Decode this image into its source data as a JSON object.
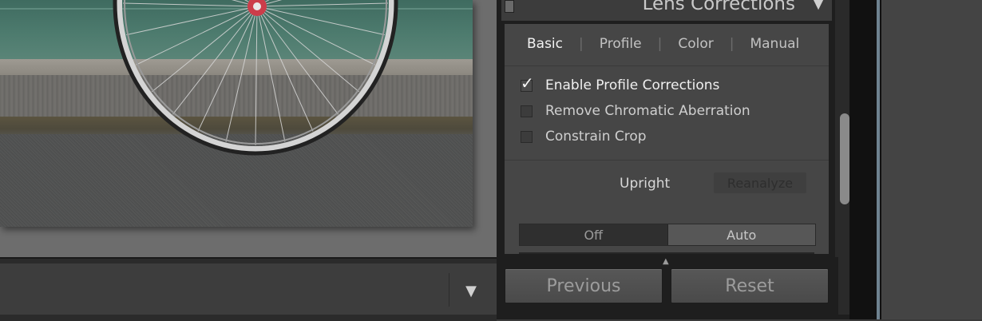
{
  "panel": {
    "title": "Lens Corrections",
    "collapse_icon": "triangle-down-icon",
    "tabs": [
      {
        "label": "Basic",
        "active": true
      },
      {
        "label": "Profile",
        "active": false
      },
      {
        "label": "Color",
        "active": false
      },
      {
        "label": "Manual",
        "active": false
      }
    ],
    "checkboxes": [
      {
        "label": "Enable Profile Corrections",
        "checked": true
      },
      {
        "label": "Remove Chromatic Aberration",
        "checked": false
      },
      {
        "label": "Constrain Crop",
        "checked": false
      }
    ],
    "upright": {
      "label": "Upright",
      "reanalyze_label": "Reanalyze",
      "buttons": [
        {
          "label": "Off",
          "selected": false
        },
        {
          "label": "Auto",
          "selected": true
        }
      ]
    }
  },
  "footer": {
    "previous_label": "Previous",
    "reset_label": "Reset"
  },
  "toolbar": {
    "dropdown_icon": "triangle-down-icon"
  },
  "colors": {
    "panel_bg": "#464646",
    "panel_frame": "#1e1e1e",
    "selected_segment": "#575757"
  }
}
